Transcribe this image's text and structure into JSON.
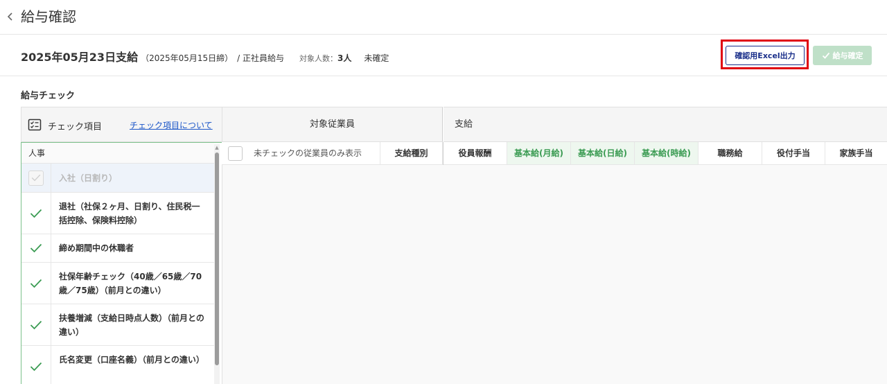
{
  "header": {
    "title": "給与確認"
  },
  "summary": {
    "pay_date": "2025年05月23日支給",
    "closing_date": "（2025年05月15日締）",
    "payroll_type": "/ 正社員給与",
    "target_count_label": "対象人数：",
    "target_count_value": "3人",
    "status": "未確定"
  },
  "actions": {
    "excel_button_label": "確認用Excel出力",
    "confirm_button_label": "給与確定"
  },
  "section": {
    "title": "給与チェック"
  },
  "check_panel": {
    "header_label": "チェック項目",
    "header_link": "チェック項目について",
    "category": "人事",
    "items": [
      {
        "label": "入社（日割り）",
        "checked": false,
        "disabled": true
      },
      {
        "label": "退社（社保２ヶ月、日割り、住民税一括控除、保険料控除）",
        "checked": true,
        "disabled": false
      },
      {
        "label": "締め期間中の休職者",
        "checked": true,
        "disabled": false
      },
      {
        "label": "社保年齢チェック（40歳／65歳／70歳／75歳）（前月との違い）",
        "checked": true,
        "disabled": false
      },
      {
        "label": "扶養増減（支給日時点人数）（前月との違い）",
        "checked": true,
        "disabled": false
      },
      {
        "label": "氏名変更（口座名義）（前月との違い）",
        "checked": true,
        "disabled": false
      }
    ]
  },
  "table": {
    "group_employee": "対象従業員",
    "group_payment": "支給",
    "filter_label": "未チェックの従業員のみ表示",
    "columns": {
      "pay_type": "支給種別",
      "officer_pay": "役員報酬",
      "base_monthly": "基本給(月給)",
      "base_daily": "基本給(日給)",
      "base_hourly": "基本給(時給)",
      "job_pay": "職務給",
      "position_allowance": "役付手当",
      "family_allowance": "家族手当"
    }
  },
  "colors": {
    "accent_green": "#3a9b52",
    "excel_border": "#1a2f8a",
    "highlight_red": "#e0000f",
    "confirm_disabled": "#bfe0c8",
    "link_blue": "#1a55c8"
  }
}
